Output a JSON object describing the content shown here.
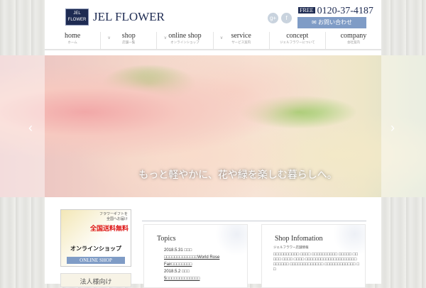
{
  "header": {
    "logo_text": "JEL FLOWER",
    "brand": "JEL FLOWER",
    "phone_badge": "FREE",
    "phone": "0120-37-4187",
    "contact_label": "✉ お問い合わせ",
    "social": [
      "g+",
      "f"
    ]
  },
  "nav": [
    {
      "en": "home",
      "jp": "ホーム"
    },
    {
      "en": "shop",
      "jp": "店舗一覧"
    },
    {
      "en": "online shop",
      "jp": "オンラインショップ"
    },
    {
      "en": "service",
      "jp": "サービス案内"
    },
    {
      "en": "concept",
      "jp": "ジェルフラワーについて"
    },
    {
      "en": "company",
      "jp": "会社案内"
    }
  ],
  "hero": {
    "caption": "もっと軽やかに、花や緑を楽しむ暮らしへ。",
    "prev": "‹",
    "next": "›"
  },
  "sidebar": {
    "banner_line1": "フラワーギフトを",
    "banner_line2": "全国へお届け",
    "banner_promo": "全国送料無料",
    "banner_title": "オンラインショップ",
    "banner_button": "ONLINE SHOP",
    "banner2": "法人様向け"
  },
  "topics": {
    "title": "Topics",
    "items": [
      {
        "date": "2018.5.31 □□□",
        "text": "□□□□□□□□□□□□□World Rose Fair□□□□□□□□"
      },
      {
        "date": "2018.5.2 □□□",
        "text": "5□□□□□□□□□□□□□"
      }
    ]
  },
  "shop": {
    "title": "Shop Infomation",
    "subtitle": "ジェルフラワー店舗情報",
    "text": "□□□□□□□□□□ □□□□ □□□□□□□□□□ □□□□□ □□ □□□ □□□□ □□□□ □□□□□□□□□□□□□□□□□□□□ □□□□□□ □□□□□□□□□□□□□ □□□□□□□□□□□□ □□"
  }
}
